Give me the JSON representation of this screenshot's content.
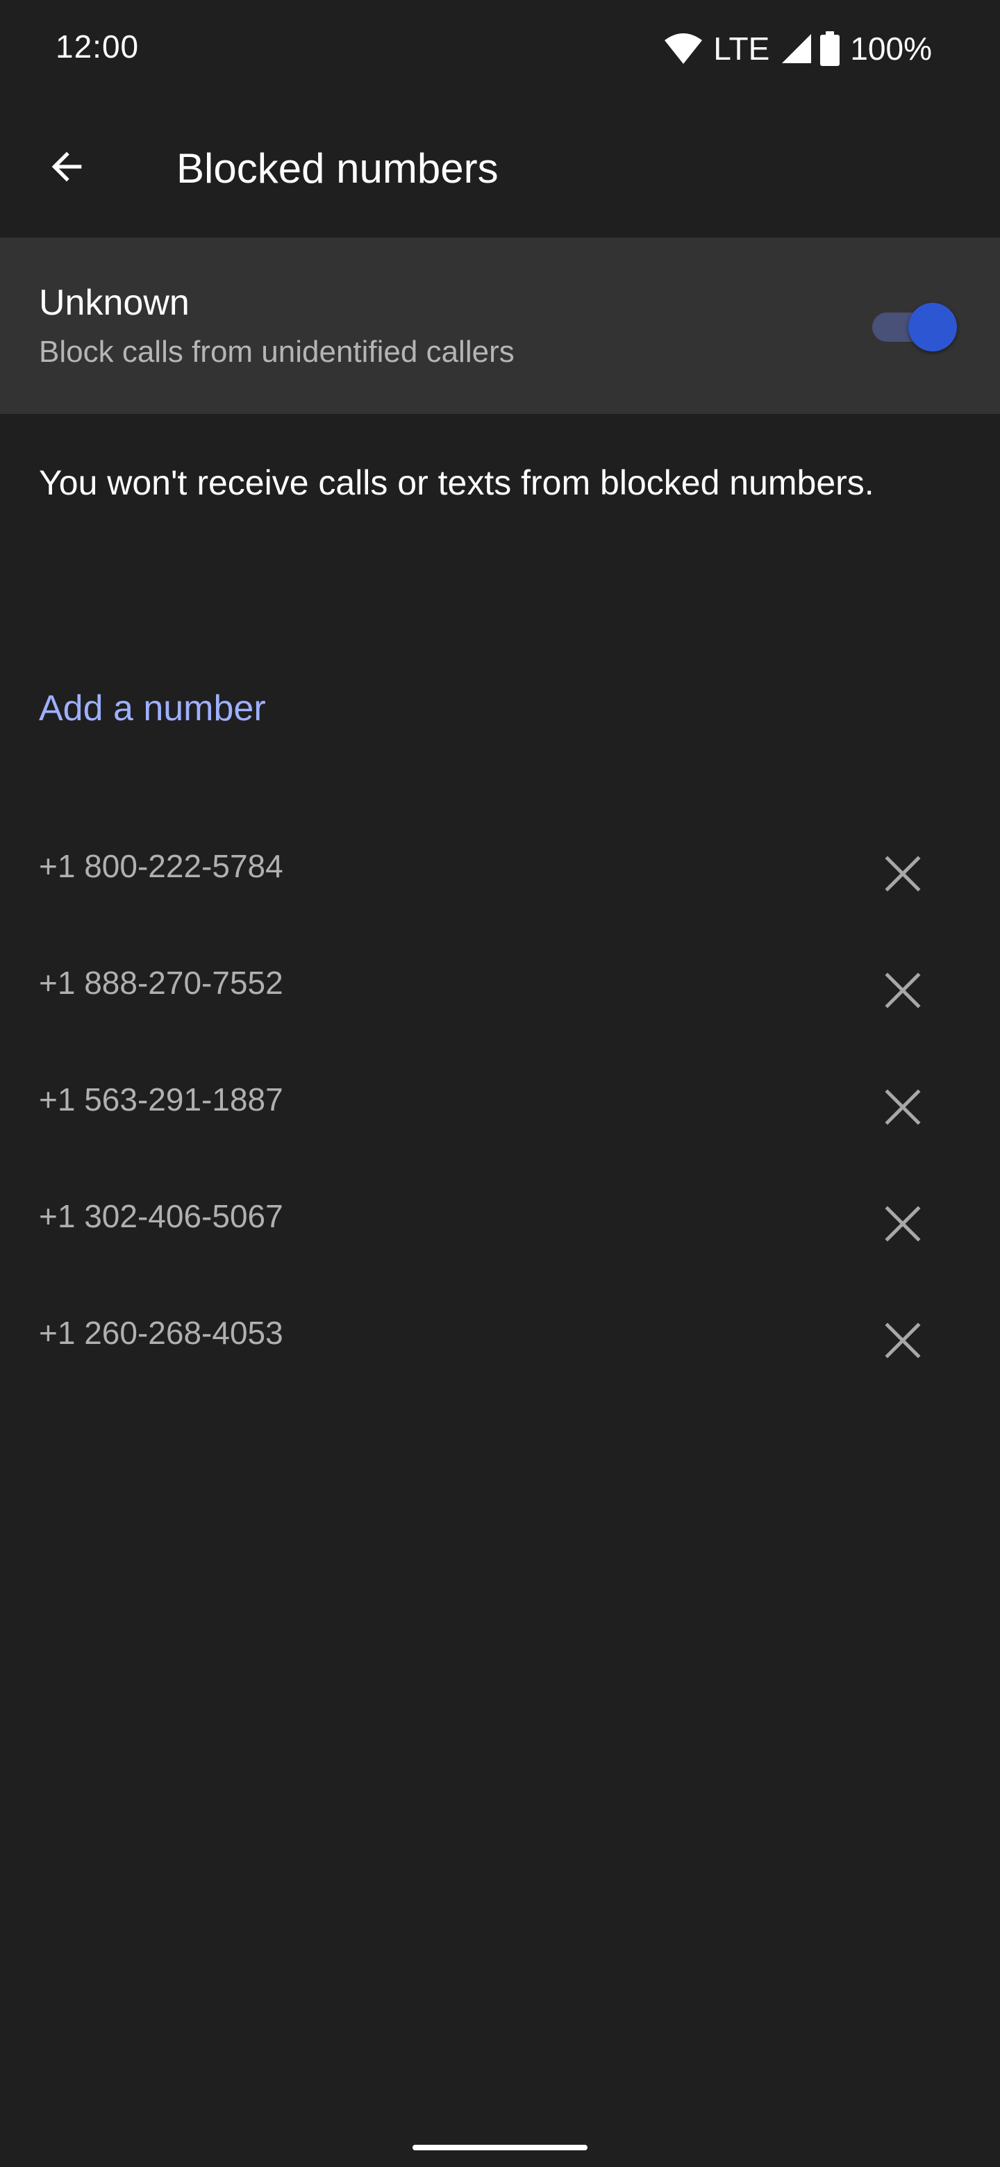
{
  "status_bar": {
    "time": "12:00",
    "network": "LTE",
    "battery_percent": "100%",
    "icons": [
      "wifi-icon",
      "cell-signal-icon",
      "battery-icon"
    ]
  },
  "app_bar": {
    "title": "Blocked numbers",
    "back_icon": "arrow-back-icon"
  },
  "unknown_setting": {
    "title": "Unknown",
    "subtitle": "Block calls from unidentified callers",
    "enabled": true
  },
  "info": {
    "text": "You won't receive calls or texts from blocked numbers."
  },
  "add_number": {
    "label": "Add a number"
  },
  "blocked_numbers": [
    {
      "number": "+1 800-222-5784"
    },
    {
      "number": "+1 888-270-7552"
    },
    {
      "number": "+1 563-291-1887"
    },
    {
      "number": "+1 302-406-5067"
    },
    {
      "number": "+1 260-268-4053"
    }
  ],
  "colors": {
    "background": "#1f1f1f",
    "row_highlight": "#333333",
    "accent_link": "#9fb0ff",
    "toggle_thumb": "#2d56d2",
    "toggle_track": "#4a5178",
    "secondary_text": "#b0b0b0"
  }
}
